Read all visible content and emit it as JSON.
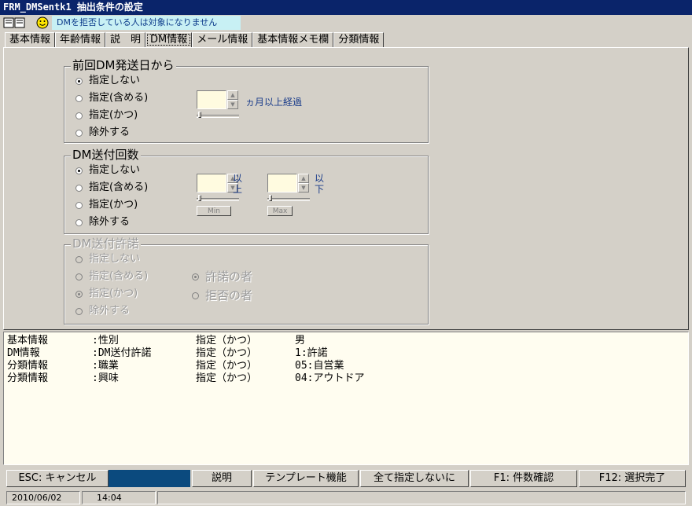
{
  "window": {
    "title": "FRM_DMSentk1 抽出条件の設定"
  },
  "notice": {
    "text": "DMを拒否している人は対象になりません"
  },
  "tabs": [
    "基本情報",
    "年齢情報",
    "説　明",
    "DM情報",
    "メール情報",
    "基本情報メモ欄",
    "分類情報"
  ],
  "active_tab": "DM情報",
  "group1": {
    "legend": "前回DM発送日から",
    "options": [
      "指定しない",
      "指定(含める)",
      "指定(かつ)",
      "除外する"
    ],
    "selected": "指定しない",
    "unit": "ヵ月以上経過"
  },
  "group2": {
    "legend": "DM送付回数",
    "options": [
      "指定しない",
      "指定(含める)",
      "指定(かつ)",
      "除外する"
    ],
    "selected": "指定しない",
    "min_unit_1": "以",
    "min_unit_2": "上",
    "max_unit_1": "以",
    "max_unit_2": "下",
    "min_label": "Min",
    "max_label": "Max"
  },
  "group3": {
    "legend": "DM送付許諾",
    "options": [
      "指定しない",
      "指定(含める)",
      "指定(かつ)",
      "除外する"
    ],
    "selected": "指定(かつ)",
    "sub_options": [
      "許諾の者",
      "拒否の者"
    ],
    "sub_selected": "許諾の者"
  },
  "results": [
    [
      "基本情報",
      ":性別",
      "指定（かつ）",
      "男"
    ],
    [
      "DM情報",
      ":DM送付許諾",
      "指定（かつ）",
      "1:許諾"
    ],
    [
      "分類情報",
      ":職業",
      "指定（かつ）",
      "05:自営業"
    ],
    [
      "分類情報",
      ":興味",
      "指定（かつ）",
      "04:アウトドア"
    ]
  ],
  "buttons": {
    "cancel": "ESC: キャンセル",
    "help": "説明",
    "template": "テンプレート機能",
    "clear_all": "全て指定しないに",
    "count": "F1: 件数確認",
    "finish": "F12: 選択完了"
  },
  "status": {
    "date": "2010/06/02",
    "time": "14:04"
  },
  "colors": {
    "titlebar": "#0a246a",
    "notice_bg": "#c8f0f4",
    "results_bg": "#fffdf0",
    "dark_button": "#0b4a7e"
  }
}
